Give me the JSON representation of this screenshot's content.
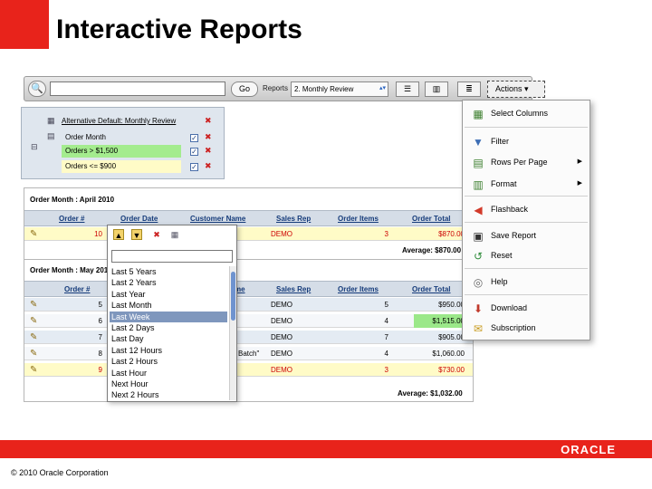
{
  "slide": {
    "title": "Interactive Reports",
    "copyright": "© 2010 Oracle Corporation",
    "logo": "ORACLE"
  },
  "colors": {
    "brand_red": "#e8231b",
    "header_blue": "#d5dde7",
    "highlight_yellow": "#fffbc7",
    "highlight_green": "#9be889"
  },
  "toolbar": {
    "go_label": "Go",
    "reports_label": "Reports",
    "report_selected": "2. Monthly Review",
    "actions_label": "Actions ▾"
  },
  "filters": {
    "default_report": "Alternative Default: Monthly Review",
    "control_break": "Order Month",
    "filter_1": "Orders > $1,500",
    "filter_2": "Orders <= $900"
  },
  "report": {
    "group1_title": "Order Month : April 2010",
    "group2_title": "Order Month : May 2010",
    "headers": [
      "Order #",
      "Order Date",
      "Customer Name",
      "Sales Rep",
      "Order Items",
      "Order Total"
    ],
    "group1_rows": [
      {
        "order": "10",
        "rep": "DEMO",
        "items": "3",
        "total": "$870.00"
      }
    ],
    "group1_avg": "Average: $870.00",
    "group2_rows": [
      {
        "order": "5",
        "customer": "",
        "rep": "DEMO",
        "items": "5",
        "total": "$950.00"
      },
      {
        "order": "6",
        "customer": "",
        "rep": "DEMO",
        "items": "4",
        "total": "$1,515.00"
      },
      {
        "order": "7",
        "customer": "",
        "rep": "DEMO",
        "items": "7",
        "total": "$905.00"
      },
      {
        "order": "8",
        "customer": "Batch\"",
        "rep": "DEMO",
        "items": "4",
        "total": "$1,060.00"
      },
      {
        "order": "9",
        "customer": "",
        "rep": "DEMO",
        "items": "3",
        "total": "$730.00"
      }
    ],
    "group2_avg": "Average: $1,032.00",
    "group2_partial_header": "me"
  },
  "column_menu": {
    "options": [
      "Last 5 Years",
      "Last 2 Years",
      "Last Year",
      "Last Month",
      "Last Week",
      "Last 2 Days",
      "Last Day",
      "Last 12 Hours",
      "Last 2 Hours",
      "Last Hour",
      "Next Hour",
      "Next 2 Hours"
    ],
    "selected": "Last Week"
  },
  "actions_menu": {
    "items": [
      {
        "label": "Select Columns",
        "icon": "select-columns-icon"
      },
      {
        "label": "Filter",
        "icon": "filter-icon"
      },
      {
        "label": "Rows Per Page",
        "icon": "rows-per-page-icon",
        "submenu": true
      },
      {
        "label": "Format",
        "icon": "format-icon",
        "submenu": true
      },
      {
        "label": "Flashback",
        "icon": "flashback-icon"
      },
      {
        "label": "Save Report",
        "icon": "save-icon"
      },
      {
        "label": "Reset",
        "icon": "reset-icon"
      },
      {
        "label": "Help",
        "icon": "help-icon"
      },
      {
        "label": "Download",
        "icon": "download-icon"
      },
      {
        "label": "Subscription",
        "icon": "subscription-icon"
      }
    ]
  }
}
